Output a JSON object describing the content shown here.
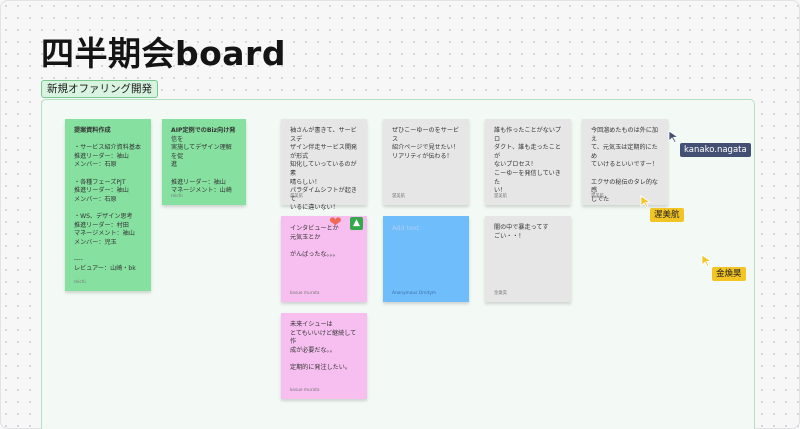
{
  "board": {
    "title": "四半期会board",
    "section_label": "新規オファリング開発"
  },
  "notes": [
    {
      "id": "note-1",
      "color": "green",
      "text": "提案資料作成\n\n・サービス紹介資料基本\n推進リーダー：袖山\nメンバー：石原\n\n・各種フェーズPJT\n推進リーダー：袖山\nメンバー：石原\n\n・WS、デザイン思考\n推進リーダー：村田\nマネージメント：袖山\nメンバー：児玉\n\n----\nレビュアー：山崎・bk",
      "author": "michi"
    },
    {
      "id": "note-2",
      "color": "green",
      "text": "AIP定例でのBiz向け発信を\n実施してデザイン理解を促\n進\n\n推進リーダー：袖山\nマネージメント：山崎",
      "author": "michi"
    },
    {
      "id": "note-3",
      "color": "grey",
      "text": "袖さんが書きて、サービスデ\nザイン伴走サービス開発が形式\n知化していっているのが素\n晴らしい！\nパラダイムシフトが起きて\nいるに違いない！",
      "author": "渥美航"
    },
    {
      "id": "note-4",
      "color": "grey",
      "text": "ぜひこーゆーのをサービス\n紹介ページで見せたい！\nリアリティが伝わる！",
      "author": "渥美航"
    },
    {
      "id": "note-5",
      "color": "grey",
      "text": "誰も作ったことがないプロ\nダクト、誰も走ったことが\nないプロセス！\nこーゆーを発信していきた\nい！",
      "author": "渥美航"
    },
    {
      "id": "note-6",
      "color": "grey",
      "text": "今回溜めたものは外に加え\nて、元気玉は定期的にため\nていけるといいですー！\n\nエクサの秘伝のタレ的な感\nじでた",
      "author": "渥美航"
    },
    {
      "id": "note-7",
      "color": "pink",
      "text": "インタビューとか\n元気玉とか\n\nがんばったな。。。",
      "author": "kosue murata"
    },
    {
      "id": "note-8",
      "color": "blue",
      "text": "Add text",
      "author": "Anonymous Ornitym"
    },
    {
      "id": "note-9",
      "color": "grey",
      "text": "闇の中で暴走ってすごい・・！",
      "author": "金煥昊"
    },
    {
      "id": "note-10",
      "color": "pink",
      "text": "未来イシューは\nとてもいいけど継続して作\n成が必要だな。。\n\n定期的に発注したい。",
      "author": "kosue murata"
    }
  ],
  "reactions": {
    "heart_icon": "heart-icon",
    "thumb_icon": "thumbs-up-icon",
    "heart_color": "#ef6b57",
    "thumb_color": "#35a84d"
  },
  "cursors": [
    {
      "name": "kanako.nagata",
      "color": "#445073"
    },
    {
      "name": "渥美航",
      "color": "#f2c424"
    },
    {
      "name": "金煥昊",
      "color": "#f2c424"
    }
  ]
}
